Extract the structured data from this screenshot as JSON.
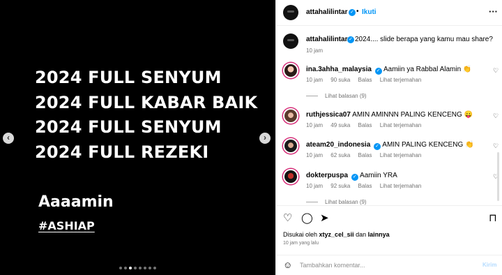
{
  "media": {
    "lines": [
      "2024 FULL SENYUM",
      "2024 FULL KABAR BAIK",
      "2024 FULL SENYUM",
      "2024 FULL REZEKI"
    ],
    "amin": "Aaaamin",
    "hashtag": "#ASHIAP",
    "prev_icon": "‹",
    "next_icon": "›",
    "slide_count": 8,
    "active_slide": 2
  },
  "header": {
    "username": "attahalilintar",
    "verified_mark": "✓",
    "separator": "•",
    "follow_label": "Ikuti",
    "more_icon": "···"
  },
  "caption": {
    "username": "attahalilintar",
    "text": "2024.... slide berapa yang kamu mau share?",
    "time": "10 jam"
  },
  "comments": [
    {
      "username": "ina.3ahha_malaysia",
      "verified": true,
      "text": "Aamiin ya Rabbal Alamin 👏",
      "time": "10 jam",
      "likes": "90 suka",
      "reply": "Balas",
      "translate": "Lihat terjemahan"
    },
    {
      "username": "ruthjessica07",
      "verified": false,
      "text": "AMIN AMINNN PALING KENCENG 😛",
      "time": "10 jam",
      "likes": "49 suka",
      "reply": "Balas",
      "translate": "Lihat terjemahan"
    },
    {
      "username": "ateam20_indonesia",
      "verified": true,
      "text": "AMIN PALING KENCENG 👏",
      "time": "10 jam",
      "likes": "62 suka",
      "reply": "Balas",
      "translate": "Lihat terjemahan"
    },
    {
      "username": "dokterpuspa",
      "verified": true,
      "text": "Aamiin YRA",
      "time": "10 jam",
      "likes": "92 suka",
      "reply": "Balas",
      "translate": "Lihat terjemahan"
    }
  ],
  "replies_1": "Lihat balasan (9)",
  "replies_4": "Lihat balasan (9)",
  "heart_icon": "♡",
  "actions": {
    "like_icon": "♡",
    "comment_icon": "◯",
    "share_icon": "➤",
    "save_icon": "⊓"
  },
  "likes": {
    "prefix": "Disukai oleh",
    "user": "xtyz_cel_sii",
    "middle": "dan",
    "suffix": "lainnya"
  },
  "posted": "10 jam yang lalu",
  "composer": {
    "emoji_icon": "☺",
    "placeholder": "Tambahkan komentar...",
    "send_label": "Kirim"
  }
}
